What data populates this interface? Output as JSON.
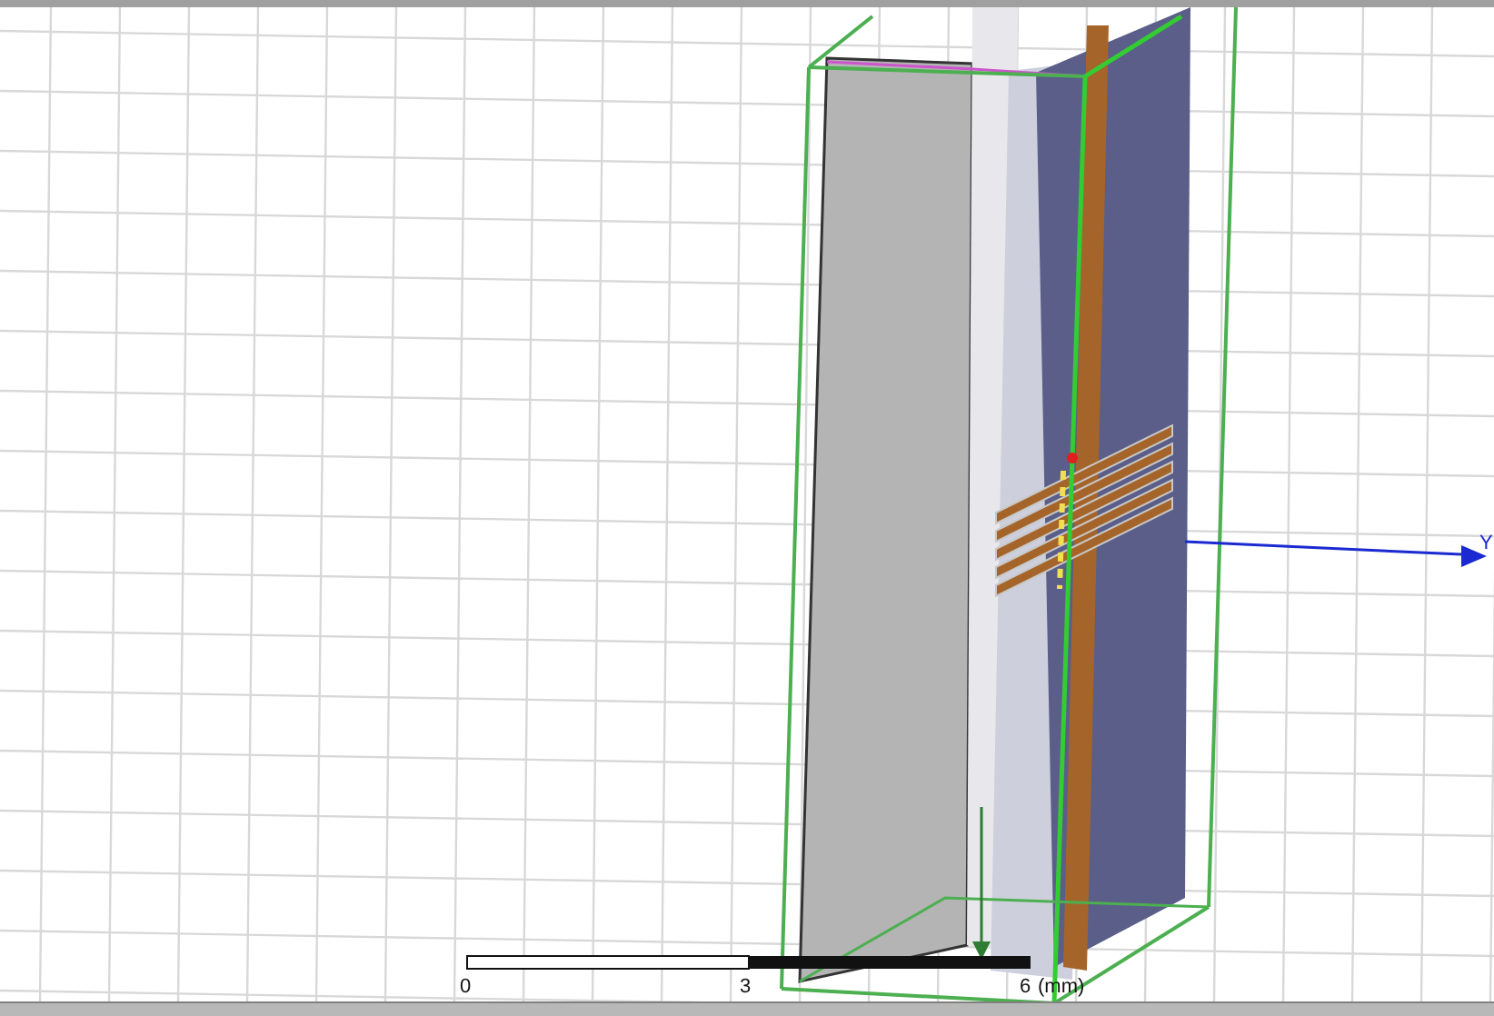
{
  "viewport": {
    "axis": {
      "label": "Y"
    },
    "scale_bar": {
      "labels": [
        "0",
        "3",
        "6"
      ],
      "unit": "(mm)"
    }
  }
}
